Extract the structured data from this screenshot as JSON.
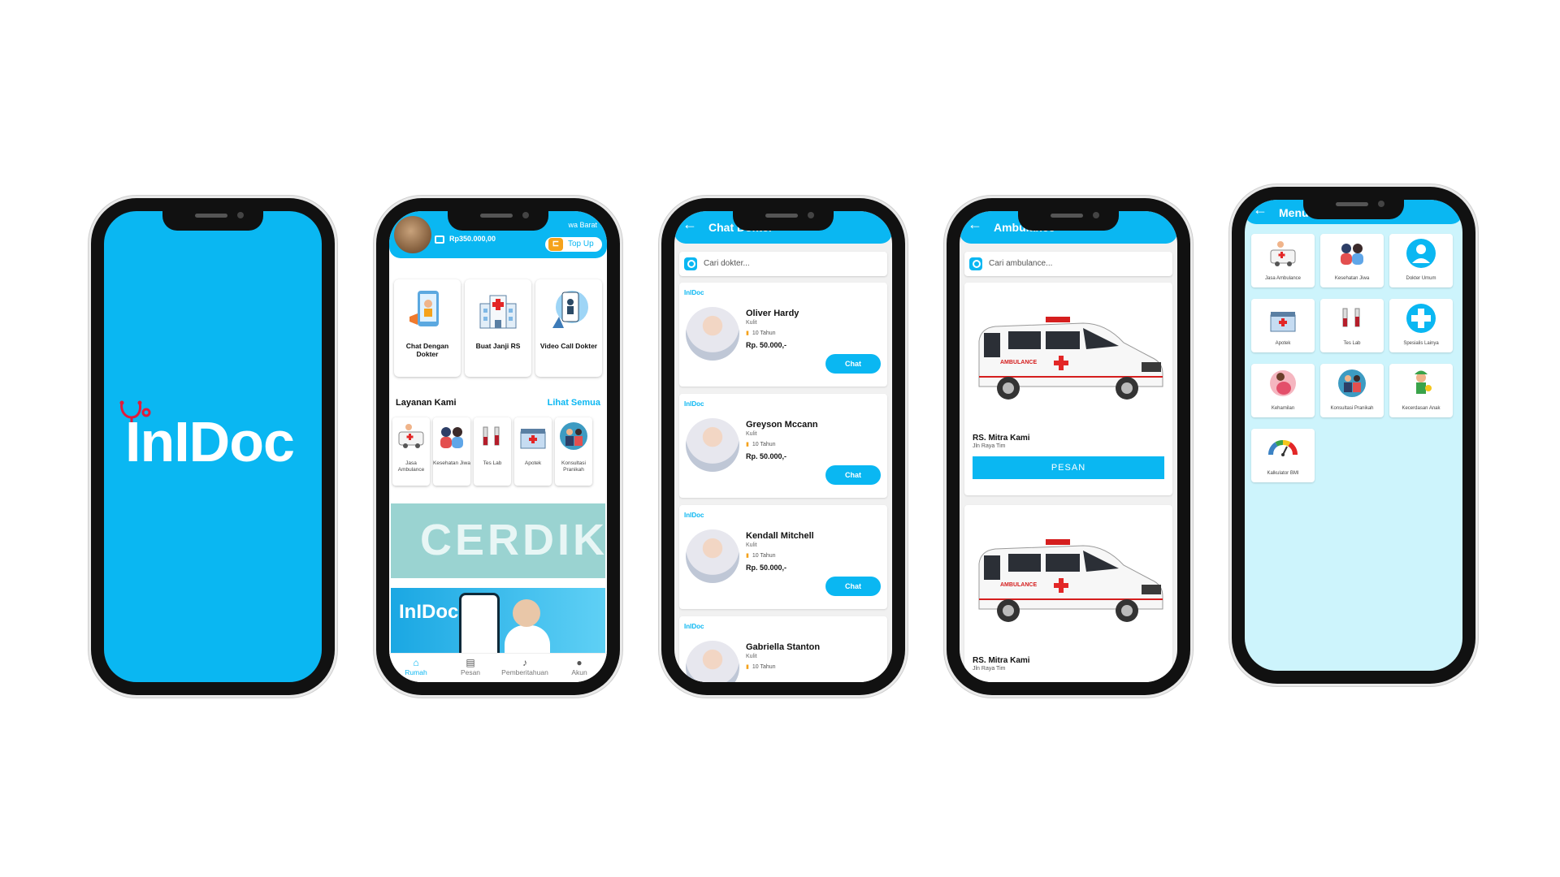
{
  "splash": {
    "logo": "InIDoc"
  },
  "home": {
    "balance": "Rp350.000,00",
    "region": "wa Barat",
    "topup": "Top Up",
    "features": [
      {
        "label": "Chat Dengan Dokter",
        "icon": "phone-chat-illustration"
      },
      {
        "label": "Buat Janji RS",
        "icon": "hospital-illustration"
      },
      {
        "label": "Video Call Dokter",
        "icon": "video-call-illustration"
      }
    ],
    "services_title": "Layanan Kami",
    "services_link": "Lihat Semua",
    "services": [
      {
        "label": "Jasa Ambulance"
      },
      {
        "label": "Kesehatan Jiwa"
      },
      {
        "label": "Tes Lab"
      },
      {
        "label": "Apotek"
      },
      {
        "label": "Konsultasi Pranikah"
      }
    ],
    "banner1_text": "CERDIK",
    "banner2_logo": "InIDoc",
    "tabs": [
      {
        "label": "Rumah",
        "icon": "home-icon"
      },
      {
        "label": "Pesan",
        "icon": "message-icon"
      },
      {
        "label": "Pemberitahuan",
        "icon": "bell-icon"
      },
      {
        "label": "Akun",
        "icon": "user-icon"
      }
    ]
  },
  "chat": {
    "title": "Chat Dokter",
    "search_placeholder": "Cari dokter...",
    "brand": "InIDoc",
    "doctors": [
      {
        "name": "Oliver Hardy",
        "specialty": "Kulit",
        "experience": "10 Tahun",
        "price": "Rp. 50.000,-",
        "action": "Chat"
      },
      {
        "name": "Greyson Mccann",
        "specialty": "Kulit",
        "experience": "10 Tahun",
        "price": "Rp. 50.000,-",
        "action": "Chat"
      },
      {
        "name": "Kendall Mitchell",
        "specialty": "Kulit",
        "experience": "10 Tahun",
        "price": "Rp. 50.000,-",
        "action": "Chat"
      },
      {
        "name": "Gabriella Stanton",
        "specialty": "Kulit",
        "experience": "10 Tahun",
        "price": "",
        "action": ""
      }
    ]
  },
  "ambulance": {
    "title": "Ambulance",
    "search_placeholder": "Cari ambulance...",
    "items": [
      {
        "hospital": "RS. Mitra Kami",
        "address": "Jln Raya Tim",
        "action": "PESAN",
        "van_label": "AMBULANCE"
      },
      {
        "hospital": "RS. Mitra Kami",
        "address": "Jln Raya Tim",
        "action": "",
        "van_label": "AMBULANCE"
      }
    ]
  },
  "menu": {
    "title": "Menu",
    "items": [
      {
        "label": "Jasa Ambulance"
      },
      {
        "label": "Kesehatan Jiwa"
      },
      {
        "label": "Dokter Umum"
      },
      {
        "label": "Apotek"
      },
      {
        "label": "Tes Lab"
      },
      {
        "label": "Spesialis Lainya"
      },
      {
        "label": "Kehamilan"
      },
      {
        "label": "Konsultasi Pranikah"
      },
      {
        "label": "Kecerdasan Anak"
      },
      {
        "label": "Kalkulator BMI"
      }
    ]
  },
  "colors": {
    "primary": "#0ab7f2",
    "menu_bg": "#cdf4fc",
    "accent_orange": "#f5a21b",
    "cross_red": "#e32727"
  }
}
